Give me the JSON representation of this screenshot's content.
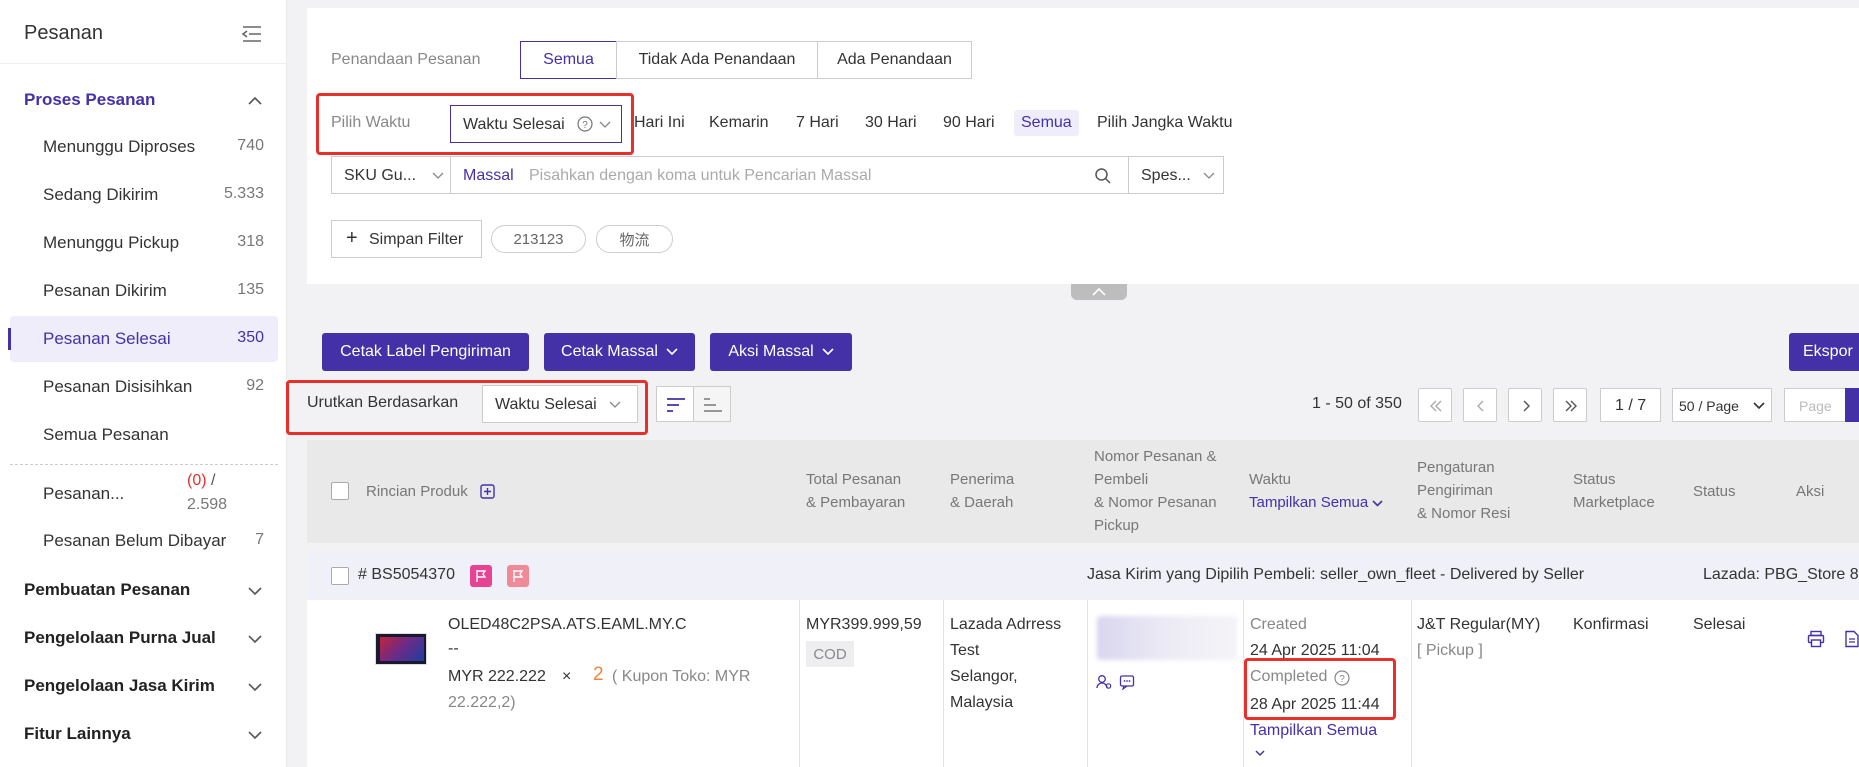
{
  "sidebar": {
    "title": "Pesanan",
    "groups": {
      "proses": "Proses Pesanan",
      "pembuatan": "Pembuatan Pesanan",
      "purna_jual": "Pengelolaan Purna Jual",
      "jasa_kirim": "Pengelolaan Jasa Kirim",
      "fitur": "Fitur Lainnya"
    },
    "items": [
      {
        "label": "Menunggu Diproses",
        "count": "740"
      },
      {
        "label": "Sedang Dikirim",
        "count": "5.333"
      },
      {
        "label": "Menunggu Pickup",
        "count": "318"
      },
      {
        "label": "Pesanan Dikirim",
        "count": "135"
      },
      {
        "label": "Pesanan Selesai",
        "count": "350"
      },
      {
        "label": "Pesanan Disisihkan",
        "count": "92"
      },
      {
        "label": "Semua Pesanan",
        "count": ""
      }
    ],
    "pesanan_special": {
      "label": "Pesanan...",
      "count_red": "(0)",
      "slash": "/",
      "total": "2.598"
    },
    "belum_dibayar": {
      "label": "Pesanan Belum Dibayar",
      "count": "7"
    }
  },
  "filters": {
    "penandaan_label": "Penandaan Pesanan",
    "penandaan_options": [
      "Semua",
      "Tidak Ada Penandaan",
      "Ada Penandaan"
    ],
    "waktu_label": "Pilih Waktu",
    "waktu_select": "Waktu Selesai",
    "waktu_options": [
      "Hari Ini",
      "Kemarin",
      "7 Hari",
      "30 Hari",
      "90 Hari",
      "Semua",
      "Pilih Jangka Waktu"
    ],
    "sku_select": "SKU Gu...",
    "massal_label": "Massal",
    "search_placeholder": "Pisahkan dengan koma untuk Pencarian Massal",
    "spes_select": "Spes...",
    "save_filter": "Simpan Filter",
    "saved_filters": [
      "213123",
      "物流"
    ]
  },
  "toolbar": {
    "cetak_label": "Cetak Label Pengiriman",
    "cetak_massal": "Cetak Massal",
    "aksi_massal": "Aksi Massal",
    "ekspor": "Ekspor",
    "sort_label": "Urutkan Berdasarkan",
    "sort_select": "Waktu Selesai",
    "range": "1 - 50 of 350",
    "page_indicator": "1 / 7",
    "page_size": "50 / Page",
    "page_input_placeholder": "Page"
  },
  "table": {
    "headers": {
      "produk": "Rincian Produk",
      "total": [
        "Total Pesanan",
        "& Pembayaran"
      ],
      "penerima": [
        "Penerima",
        "& Daerah"
      ],
      "nomor": [
        "Nomor Pesanan &",
        "Pembeli",
        "& Nomor Pesanan",
        "Pickup"
      ],
      "waktu": "Waktu",
      "tampilkan": "Tampilkan Semua",
      "pengaturan": [
        "Pengaturan",
        "Pengiriman",
        "& Nomor Resi"
      ],
      "status_mp": [
        "Status",
        "Marketplace"
      ],
      "status": "Status",
      "aksi": "Aksi"
    },
    "order": {
      "id": "# BS5054370",
      "shipping_info": "Jasa Kirim yang Dipilih Pembeli: seller_own_fleet - Delivered by Seller",
      "store": "Lazada: PBG_Store 8",
      "product_sku": "OLED48C2PSA.ATS.EAML.MY.C",
      "product_dash": "--",
      "price": "MYR 222.222",
      "times": "×",
      "qty": "2",
      "coupon": "( Kupon Toko: MYR 22.222,2)",
      "total": "MYR399.999,59",
      "payment": "COD",
      "receiver": [
        "Lazada Adrress",
        "Test",
        "Selangor,",
        "Malaysia"
      ],
      "created_label": "Created",
      "created_time": "24 Apr 2025 11:04",
      "completed_label": "Completed",
      "completed_time": "28 Apr 2025 11:44",
      "show_all": "Tampilkan Semua",
      "shipping": "J&T Regular(MY)",
      "pickup": "[ Pickup ]",
      "status_mp": "Konfirmasi",
      "status": "Selesai"
    }
  },
  "colors": {
    "primary": "#4431a8",
    "highlight": "#e8302a",
    "flag_pink": "#e84393"
  }
}
